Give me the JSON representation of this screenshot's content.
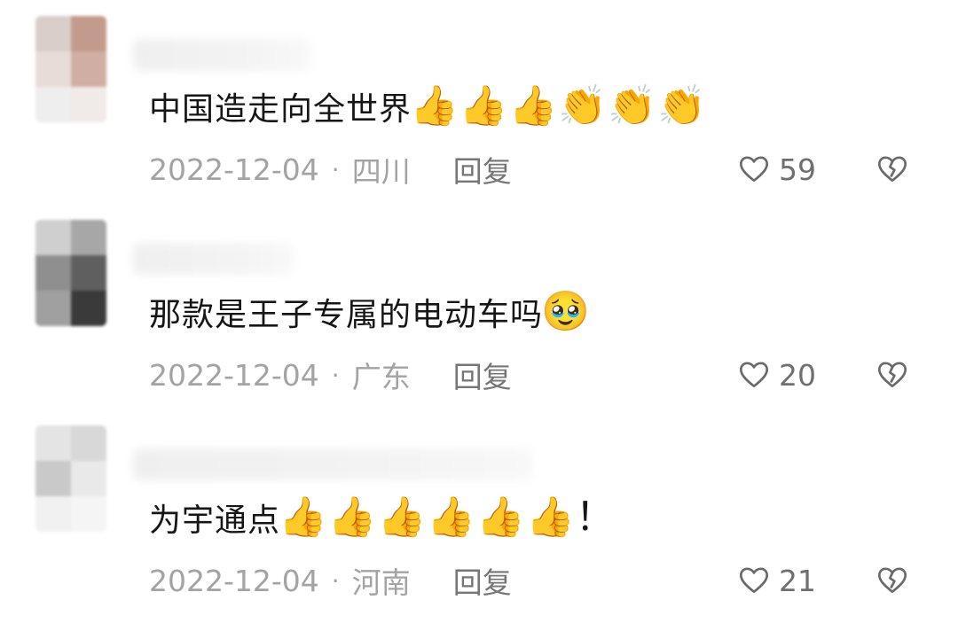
{
  "comments": [
    {
      "text": "中国造走向全世界",
      "emoji_suffix": "👍👍👍👏👏👏",
      "date": "2022-12-04",
      "separator": "·",
      "location": "四川",
      "reply_label": "回复",
      "likes": "59",
      "avatar_colors": [
        "#d9cec9",
        "#c29b8c",
        "#e8dcd8",
        "#d1aea3",
        "#eeeeee",
        "#f0eae8"
      ]
    },
    {
      "text": "那款是王子专属的电动车吗",
      "emoji_suffix": "🥹",
      "date": "2022-12-04",
      "separator": "·",
      "location": "广东",
      "reply_label": "回复",
      "likes": "20",
      "avatar_colors": [
        "#cfcfcf",
        "#a7a7a7",
        "#8f8f8f",
        "#5f5f5f",
        "#a0a0a0",
        "#3a3a3a"
      ]
    },
    {
      "text": "为宇通点",
      "emoji_suffix": "👍👍👍👍👍👍！",
      "date": "2022-12-04",
      "separator": "·",
      "location": "河南",
      "reply_label": "回复",
      "likes": "21",
      "avatar_colors": [
        "#e4e4e4",
        "#d8d8d8",
        "#c9c9c9",
        "#e9e9e9",
        "#f1f1f1",
        "#f5f5f5"
      ]
    }
  ]
}
